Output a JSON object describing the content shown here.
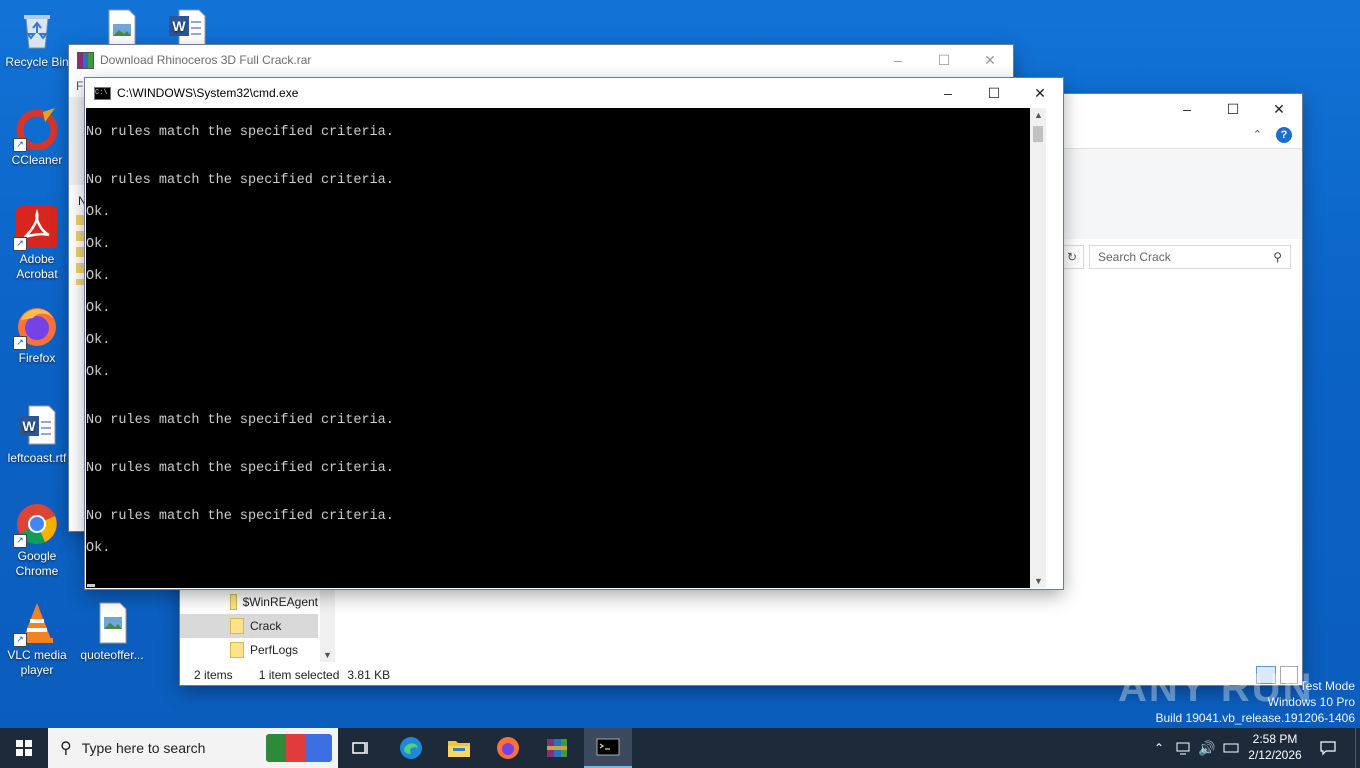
{
  "desktop": {
    "icons": [
      {
        "label": "Recycle Bin"
      },
      {
        "label": "CCleaner"
      },
      {
        "label": "Adobe Acrobat"
      },
      {
        "label": "Firefox"
      },
      {
        "label": "leftcoast.rtf"
      },
      {
        "label": "Google Chrome"
      },
      {
        "label": "VLC media player"
      },
      {
        "label": "quoteoffer..."
      }
    ]
  },
  "winrar": {
    "title": "Download Rhinoceros 3D Full Crack.rar",
    "menu_first": "Fi",
    "partial_n": "N"
  },
  "explorer": {
    "search_placeholder": "Search Crack",
    "folders": [
      {
        "name": "$WinREAgent"
      },
      {
        "name": "Crack"
      },
      {
        "name": "PerfLogs"
      }
    ],
    "status_items": "2 items",
    "status_selected": "1 item selected",
    "status_size": "3.81 KB"
  },
  "cmd": {
    "title": "C:\\WINDOWS\\System32\\cmd.exe",
    "lines": [
      "No rules match the specified criteria.",
      "No rules match the specified criteria.",
      "Ok.",
      "Ok.",
      "Ok.",
      "Ok.",
      "Ok.",
      "Ok.",
      "No rules match the specified criteria.",
      "No rules match the specified criteria.",
      "No rules match the specified criteria.",
      "Ok."
    ]
  },
  "taskbar": {
    "search_placeholder": "Type here to search",
    "time": "2:58 PM",
    "date": "2/12/2026"
  },
  "watermark": {
    "line1": "Test Mode",
    "line2": "Windows 10 Pro",
    "line3": "Build 19041.vb_release.191206-1406",
    "brand": "ANY RUN"
  },
  "colors": {
    "desktop": "#0b63c6",
    "taskbar": "#1c2a3a",
    "cmd_bg": "#000000",
    "cmd_text": "#cccccc"
  }
}
